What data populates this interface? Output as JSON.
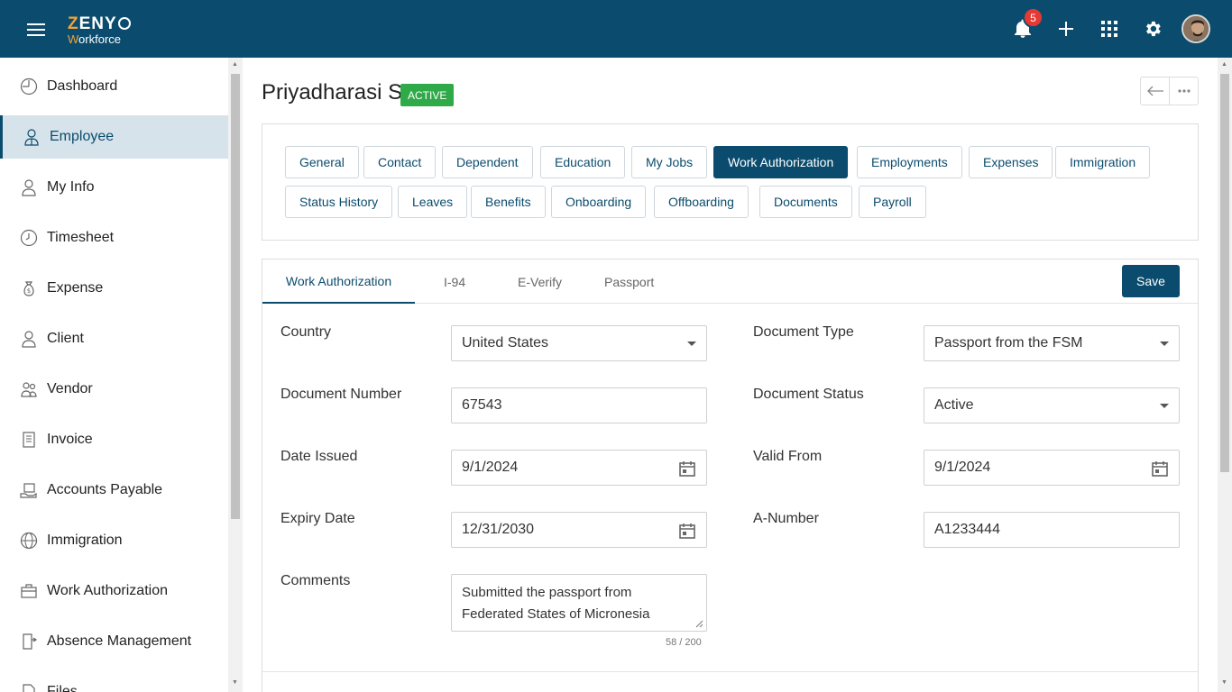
{
  "app": {
    "logo_top": "ZENY",
    "logo_bottom": "Workforce",
    "notification_count": "5"
  },
  "sidebar": {
    "items": [
      {
        "label": "Dashboard",
        "icon": "dashboard-icon"
      },
      {
        "label": "Employee",
        "icon": "employee-icon",
        "active": true
      },
      {
        "label": "My Info",
        "icon": "person-icon"
      },
      {
        "label": "Timesheet",
        "icon": "clock-icon"
      },
      {
        "label": "Expense",
        "icon": "money-bag-icon"
      },
      {
        "label": "Client",
        "icon": "user-icon"
      },
      {
        "label": "Vendor",
        "icon": "vendor-icon"
      },
      {
        "label": "Invoice",
        "icon": "invoice-icon"
      },
      {
        "label": "Accounts Payable",
        "icon": "payable-icon"
      },
      {
        "label": "Immigration",
        "icon": "globe-icon"
      },
      {
        "label": "Work Authorization",
        "icon": "briefcase-icon"
      },
      {
        "label": "Absence Management",
        "icon": "door-icon"
      },
      {
        "label": "Files",
        "icon": "file-icon"
      }
    ]
  },
  "header": {
    "name": "Priyadharasi S",
    "status": "ACTIVE"
  },
  "tabs": [
    "General",
    "Contact",
    "Dependent",
    "Education",
    "My Jobs",
    "Work Authorization",
    "Employments",
    "Expenses",
    "Immigration",
    "Status History",
    "Leaves",
    "Benefits",
    "Onboarding",
    "Offboarding",
    "Documents",
    "Payroll"
  ],
  "subtabs": [
    "Work Authorization",
    "I-94",
    "E-Verify",
    "Passport"
  ],
  "save_label": "Save",
  "form": {
    "country": {
      "label": "Country",
      "value": "United States"
    },
    "document_type": {
      "label": "Document Type",
      "value": "Passport from the FSM"
    },
    "document_number": {
      "label": "Document Number",
      "value": "67543"
    },
    "document_status": {
      "label": "Document Status",
      "value": "Active"
    },
    "date_issued": {
      "label": "Date Issued",
      "value": "9/1/2024"
    },
    "valid_from": {
      "label": "Valid From",
      "value": "9/1/2024"
    },
    "expiry_date": {
      "label": "Expiry Date",
      "value": "12/31/2030"
    },
    "a_number": {
      "label": "A-Number",
      "value": "A1233444"
    },
    "comments": {
      "label": "Comments",
      "value": "Submitted the passport from Federated States of Micronesia",
      "counter": "58 / 200"
    }
  },
  "colors": {
    "primary": "#0b4c6e",
    "active_badge": "#2eaa48",
    "notification": "#e53935"
  }
}
